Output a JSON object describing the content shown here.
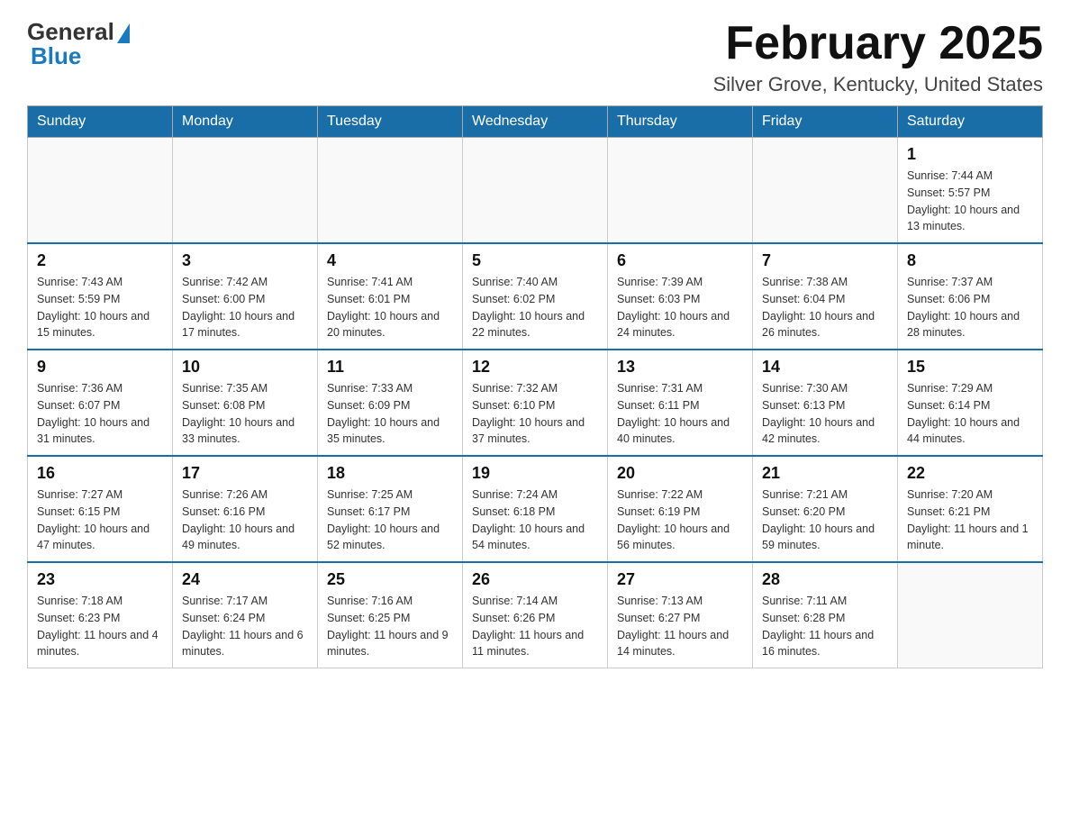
{
  "header": {
    "logo_general": "General",
    "logo_blue": "Blue",
    "month_title": "February 2025",
    "location": "Silver Grove, Kentucky, United States"
  },
  "days_of_week": [
    "Sunday",
    "Monday",
    "Tuesday",
    "Wednesday",
    "Thursday",
    "Friday",
    "Saturday"
  ],
  "weeks": [
    [
      {
        "day": "",
        "info": ""
      },
      {
        "day": "",
        "info": ""
      },
      {
        "day": "",
        "info": ""
      },
      {
        "day": "",
        "info": ""
      },
      {
        "day": "",
        "info": ""
      },
      {
        "day": "",
        "info": ""
      },
      {
        "day": "1",
        "info": "Sunrise: 7:44 AM\nSunset: 5:57 PM\nDaylight: 10 hours and 13 minutes."
      }
    ],
    [
      {
        "day": "2",
        "info": "Sunrise: 7:43 AM\nSunset: 5:59 PM\nDaylight: 10 hours and 15 minutes."
      },
      {
        "day": "3",
        "info": "Sunrise: 7:42 AM\nSunset: 6:00 PM\nDaylight: 10 hours and 17 minutes."
      },
      {
        "day": "4",
        "info": "Sunrise: 7:41 AM\nSunset: 6:01 PM\nDaylight: 10 hours and 20 minutes."
      },
      {
        "day": "5",
        "info": "Sunrise: 7:40 AM\nSunset: 6:02 PM\nDaylight: 10 hours and 22 minutes."
      },
      {
        "day": "6",
        "info": "Sunrise: 7:39 AM\nSunset: 6:03 PM\nDaylight: 10 hours and 24 minutes."
      },
      {
        "day": "7",
        "info": "Sunrise: 7:38 AM\nSunset: 6:04 PM\nDaylight: 10 hours and 26 minutes."
      },
      {
        "day": "8",
        "info": "Sunrise: 7:37 AM\nSunset: 6:06 PM\nDaylight: 10 hours and 28 minutes."
      }
    ],
    [
      {
        "day": "9",
        "info": "Sunrise: 7:36 AM\nSunset: 6:07 PM\nDaylight: 10 hours and 31 minutes."
      },
      {
        "day": "10",
        "info": "Sunrise: 7:35 AM\nSunset: 6:08 PM\nDaylight: 10 hours and 33 minutes."
      },
      {
        "day": "11",
        "info": "Sunrise: 7:33 AM\nSunset: 6:09 PM\nDaylight: 10 hours and 35 minutes."
      },
      {
        "day": "12",
        "info": "Sunrise: 7:32 AM\nSunset: 6:10 PM\nDaylight: 10 hours and 37 minutes."
      },
      {
        "day": "13",
        "info": "Sunrise: 7:31 AM\nSunset: 6:11 PM\nDaylight: 10 hours and 40 minutes."
      },
      {
        "day": "14",
        "info": "Sunrise: 7:30 AM\nSunset: 6:13 PM\nDaylight: 10 hours and 42 minutes."
      },
      {
        "day": "15",
        "info": "Sunrise: 7:29 AM\nSunset: 6:14 PM\nDaylight: 10 hours and 44 minutes."
      }
    ],
    [
      {
        "day": "16",
        "info": "Sunrise: 7:27 AM\nSunset: 6:15 PM\nDaylight: 10 hours and 47 minutes."
      },
      {
        "day": "17",
        "info": "Sunrise: 7:26 AM\nSunset: 6:16 PM\nDaylight: 10 hours and 49 minutes."
      },
      {
        "day": "18",
        "info": "Sunrise: 7:25 AM\nSunset: 6:17 PM\nDaylight: 10 hours and 52 minutes."
      },
      {
        "day": "19",
        "info": "Sunrise: 7:24 AM\nSunset: 6:18 PM\nDaylight: 10 hours and 54 minutes."
      },
      {
        "day": "20",
        "info": "Sunrise: 7:22 AM\nSunset: 6:19 PM\nDaylight: 10 hours and 56 minutes."
      },
      {
        "day": "21",
        "info": "Sunrise: 7:21 AM\nSunset: 6:20 PM\nDaylight: 10 hours and 59 minutes."
      },
      {
        "day": "22",
        "info": "Sunrise: 7:20 AM\nSunset: 6:21 PM\nDaylight: 11 hours and 1 minute."
      }
    ],
    [
      {
        "day": "23",
        "info": "Sunrise: 7:18 AM\nSunset: 6:23 PM\nDaylight: 11 hours and 4 minutes."
      },
      {
        "day": "24",
        "info": "Sunrise: 7:17 AM\nSunset: 6:24 PM\nDaylight: 11 hours and 6 minutes."
      },
      {
        "day": "25",
        "info": "Sunrise: 7:16 AM\nSunset: 6:25 PM\nDaylight: 11 hours and 9 minutes."
      },
      {
        "day": "26",
        "info": "Sunrise: 7:14 AM\nSunset: 6:26 PM\nDaylight: 11 hours and 11 minutes."
      },
      {
        "day": "27",
        "info": "Sunrise: 7:13 AM\nSunset: 6:27 PM\nDaylight: 11 hours and 14 minutes."
      },
      {
        "day": "28",
        "info": "Sunrise: 7:11 AM\nSunset: 6:28 PM\nDaylight: 11 hours and 16 minutes."
      },
      {
        "day": "",
        "info": ""
      }
    ]
  ]
}
